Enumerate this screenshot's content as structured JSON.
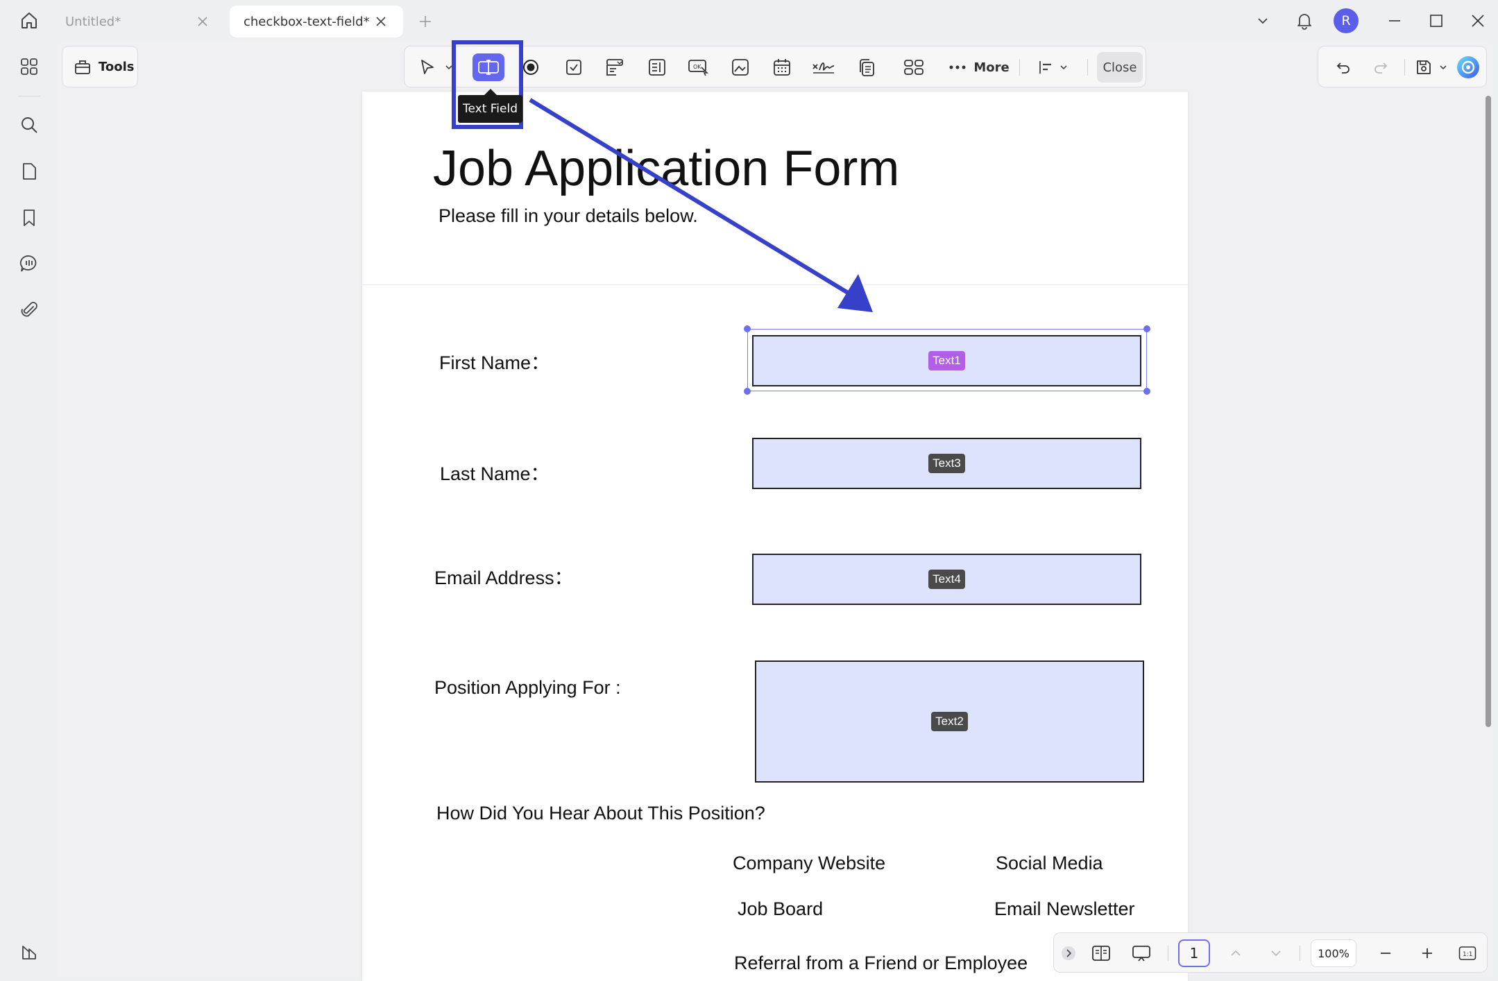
{
  "window": {
    "tabs": [
      {
        "label": "Untitled*",
        "active": false
      },
      {
        "label": "checkbox-text-field*",
        "active": true
      }
    ],
    "avatar_initial": "R"
  },
  "tools_button": {
    "label": "Tools"
  },
  "toolbar": {
    "more_label": "More",
    "close_label": "Close",
    "tooltip": "Text Field",
    "accent_color": "#6466ee"
  },
  "document": {
    "title": "Job Application Form",
    "subtitle": "Please fill in your details below.",
    "fields": [
      {
        "label": "First Name：",
        "tag": "Text1",
        "selected": true
      },
      {
        "label": "Last Name：",
        "tag": "Text3",
        "selected": false
      },
      {
        "label": "Email Address：",
        "tag": "Text4",
        "selected": false
      },
      {
        "label": "Position Applying For :",
        "tag": "Text2",
        "selected": false
      }
    ],
    "question": "How Did You Hear About This Position?",
    "options": [
      "Company Website",
      "Social Media",
      "Job Board",
      "Email Newsletter",
      "Referral from a Friend or Employee"
    ]
  },
  "statusbar": {
    "page_number": "1",
    "zoom": "100%"
  },
  "annotation": {
    "highlight_color": "#3640c8"
  }
}
